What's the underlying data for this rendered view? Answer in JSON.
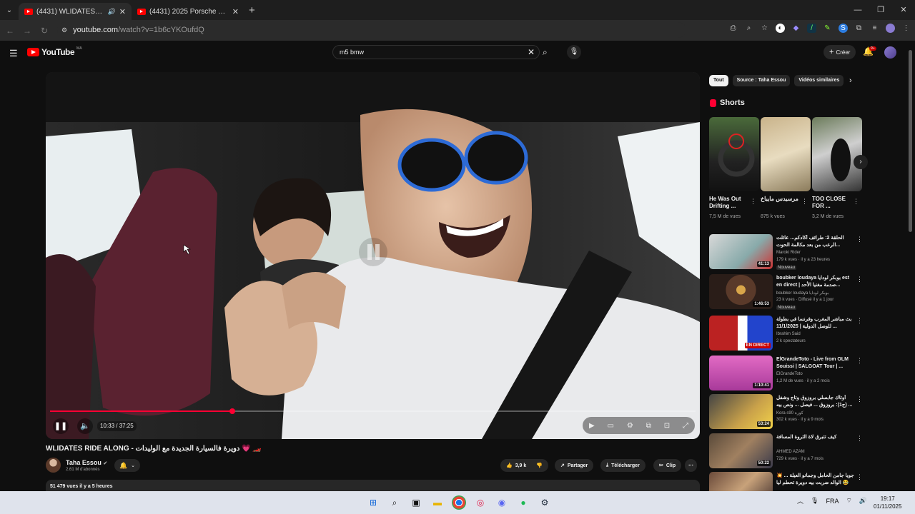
{
  "browser": {
    "tabs": [
      {
        "title": "(4431) WLIDATES RIDE ALO",
        "active": true
      },
      {
        "title": "(4431) 2025 Porsche Macan S -",
        "active": false
      }
    ],
    "url_host": "youtube.com",
    "url_path": "/watch?v=1b6cYKOufdQ"
  },
  "header": {
    "logo_text": "YouTube",
    "country_code": "MA",
    "search_value": "m5 bmw",
    "create_label": "Créer",
    "notif_count": "9+"
  },
  "player": {
    "time": "10:33 / 37:25",
    "progress": 0.282
  },
  "video": {
    "title": "WLIDATES RIDE ALONG - دويرة فالسيارة الجديدة مع الوليدات 💗 🏎️",
    "channel": "Taha Essou",
    "subscribers": "2,61 M d'abonnés",
    "likes": "3,9 k",
    "share_label": "Partager",
    "download_label": "Télécharger",
    "clip_label": "Clip",
    "views_line": "51 479 vues  il y a 5 heures"
  },
  "sidebar": {
    "chips": [
      "Tout",
      "Source : Taha Essou",
      "Vidéos similaires"
    ],
    "shorts_title": "Shorts",
    "shorts": [
      {
        "title": "He Was Out Drifting ...",
        "views": "7,5 M de vues"
      },
      {
        "title": "مرسيدس مايباخ",
        "views": "875 k vues"
      },
      {
        "title": "TOO CLOSE FOR ...",
        "views": "3,2 M de vues"
      }
    ],
    "recs": [
      {
        "title": "الحلقة 2: طرائف أكادكم... عائلت الرعب من بعد مكالمة الحوت... Maroki 😂",
        "channel": "Maroki Rider",
        "views": "179 k vues · il y a 23 heures",
        "badge": "Nouveau",
        "duration": "41:13"
      },
      {
        "title": "boubker loudaya بوبكر لودايا est en direct | صدمة مغنيا الأحد...",
        "channel": "boubker loudaya بوبكر لودايا",
        "views": "23 k vues · Diffusé il y a 1 jour",
        "badge": "Nouveau",
        "duration": "1:46:53"
      },
      {
        "title": "بث مباشر المغرب وفرنسا في بطولة ... للوصل الدولية | 11/1/2025",
        "channel": "Ibrahim Said",
        "views": "2 k spectateurs",
        "badge": "",
        "duration": "EN DIRECT"
      },
      {
        "title": "ElGrandeToto - Live from OLM Souissi | SALGOAT Tour | ...",
        "channel": "ElGrandeToto",
        "views": "1,2 M de vues · il y a 2 mois",
        "badge": "",
        "duration": "1:10:41"
      },
      {
        "title": "أوتاك جابسلي بروزوق وتاج وشفل (ج1): بروزوق ... فيصل ... ونص بيه ...",
        "channel": "Kora s90 كورة",
        "views": "302 k vues · il y a 9 mois",
        "badge": "",
        "duration": "53:24"
      },
      {
        "title": "كيف تتبرق لاة الثروة المسافة",
        "channel": "AHMED AZAM",
        "views": "729 k vues · il y a 7 mois",
        "badge": "",
        "duration": "50:22"
      },
      {
        "title": "💥 جويا جامن الحامل وجمانو العيلة ... الوالد ضربت بيه دويرة تحطم ليا 😂",
        "channel": "",
        "views": "",
        "badge": "",
        "duration": ""
      }
    ]
  },
  "taskbar": {
    "lang": "FRA",
    "time": "19:17",
    "date": "01/11/2025"
  }
}
